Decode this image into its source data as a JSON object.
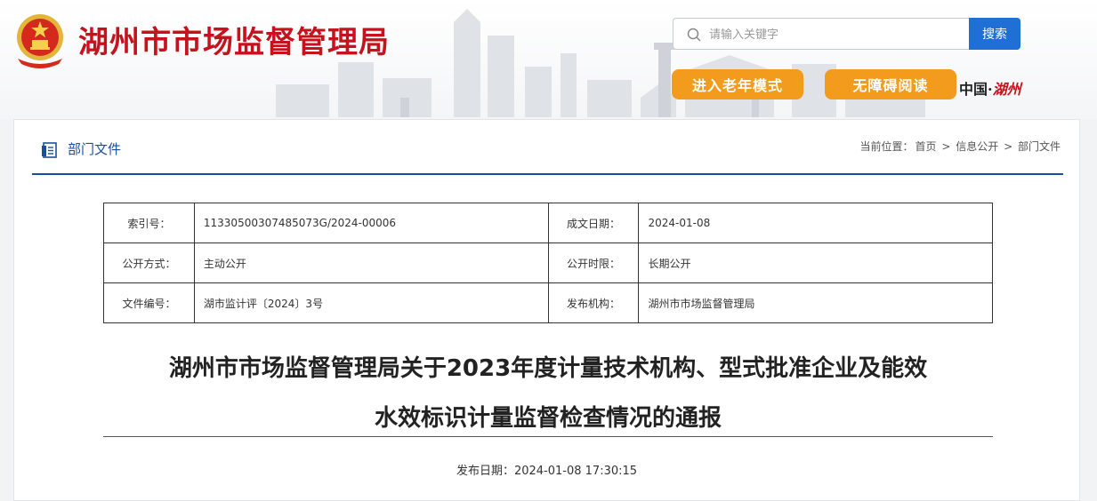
{
  "header": {
    "site_title": "湖州市市场监督管理局",
    "search": {
      "placeholder": "请输入关键字",
      "button_label": "搜索"
    },
    "elder_mode_label": "进入老年模式",
    "accessibility_label": "无障碍阅读",
    "slogan_part1": "中国·",
    "slogan_part2": "湖州",
    "colors": {
      "brand_red": "#c5121d",
      "accent_orange": "#f39b1c",
      "search_blue": "#1f6fd6"
    }
  },
  "section": {
    "title": "部门文件",
    "breadcrumb": {
      "prefix": "当前位置：",
      "items": [
        "首页",
        "信息公开",
        "部门文件"
      ],
      "separator": ">"
    }
  },
  "meta": {
    "index_label": "索引号：",
    "index_value": "11330500307485073G/2024-00006",
    "date_label": "成文日期：",
    "date_value": "2024-01-08",
    "mode_label": "公开方式：",
    "mode_value": "主动公开",
    "period_label": "公开时限：",
    "period_value": "长期公开",
    "docno_label": "文件编号：",
    "docno_value": "湖市监计评〔2024〕3号",
    "org_label": "发布机构：",
    "org_value": "湖州市市场监督管理局"
  },
  "document": {
    "title_line1": "湖州市市场监督管理局关于2023年度计量技术机构、型式批准企业及能效",
    "title_line2": "水效标识计量监督检查情况的通报",
    "publish_label": "发布日期：",
    "publish_value": "2024-01-08 17:30:15"
  }
}
